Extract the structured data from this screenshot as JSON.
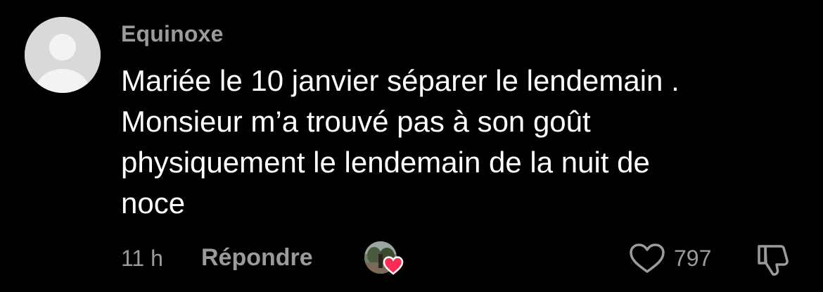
{
  "comment": {
    "username": "Equinoxe",
    "lines": [
      "Mariée le 10 janvier séparer le lendemain .",
      "Monsieur m’a trouvé pas à son goût",
      "physiquement le lendemain de la nuit de",
      "noce"
    ],
    "timestamp": "11 h",
    "reply_label": "Répondre",
    "like_count": "797"
  },
  "icons": {
    "avatar": "default-user-avatar",
    "creator_avatar": "creator-profile-photo",
    "creator_heart": "heart-filled-icon",
    "like": "heart-outline-icon",
    "dislike": "thumbs-down-icon"
  },
  "colors": {
    "background": "#000000",
    "text": "#ffffff",
    "muted": "#9b9b9b",
    "avatar_bg": "#d9d9d9",
    "heart_accent": "#fe2c55"
  }
}
